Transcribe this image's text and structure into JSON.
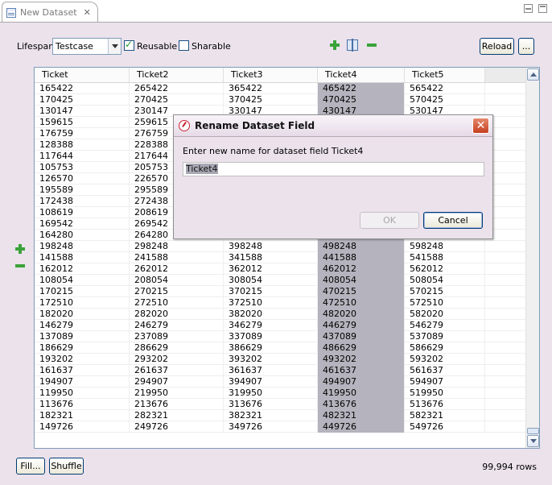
{
  "tab": {
    "title": "New Dataset",
    "close": "✕"
  },
  "toolbar": {
    "lifespan_label": "Lifespan",
    "lifespan_value": "Testcase",
    "reusable_label": "Reusable",
    "reusable_checked": true,
    "sharable_label": "Sharable",
    "sharable_checked": false,
    "reload_label": "Reload",
    "more_label": "..."
  },
  "table": {
    "columns": [
      "Ticket",
      "Ticket2",
      "Ticket3",
      "Ticket4",
      "Ticket5",
      ""
    ],
    "selected_column": "Ticket4",
    "rows": [
      [
        "165422",
        "265422",
        "365422",
        "465422",
        "565422"
      ],
      [
        "170425",
        "270425",
        "370425",
        "470425",
        "570425"
      ],
      [
        "130147",
        "230147",
        "330147",
        "430147",
        "530147"
      ],
      [
        "159615",
        "259615",
        "",
        "",
        ""
      ],
      [
        "176759",
        "276759",
        "",
        "",
        ""
      ],
      [
        "128388",
        "228388",
        "",
        "",
        ""
      ],
      [
        "117644",
        "217644",
        "",
        "",
        ""
      ],
      [
        "105753",
        "205753",
        "",
        "",
        ""
      ],
      [
        "126570",
        "226570",
        "",
        "",
        ""
      ],
      [
        "195589",
        "295589",
        "",
        "",
        ""
      ],
      [
        "172438",
        "272438",
        "",
        "",
        ""
      ],
      [
        "108619",
        "208619",
        "",
        "",
        ""
      ],
      [
        "169542",
        "269542",
        "",
        "",
        ""
      ],
      [
        "164280",
        "264280",
        "",
        "",
        ""
      ],
      [
        "198248",
        "298248",
        "398248",
        "498248",
        "598248"
      ],
      [
        "141588",
        "241588",
        "341588",
        "441588",
        "541588"
      ],
      [
        "162012",
        "262012",
        "362012",
        "462012",
        "562012"
      ],
      [
        "108054",
        "208054",
        "308054",
        "408054",
        "508054"
      ],
      [
        "170215",
        "270215",
        "370215",
        "470215",
        "570215"
      ],
      [
        "172510",
        "272510",
        "372510",
        "472510",
        "572510"
      ],
      [
        "182020",
        "282020",
        "382020",
        "482020",
        "582020"
      ],
      [
        "146279",
        "246279",
        "346279",
        "446279",
        "546279"
      ],
      [
        "137089",
        "237089",
        "337089",
        "437089",
        "537089"
      ],
      [
        "186629",
        "286629",
        "386629",
        "486629",
        "586629"
      ],
      [
        "193202",
        "293202",
        "393202",
        "493202",
        "593202"
      ],
      [
        "161637",
        "261637",
        "361637",
        "461637",
        "561637"
      ],
      [
        "194907",
        "294907",
        "394907",
        "494907",
        "594907"
      ],
      [
        "119950",
        "219950",
        "319950",
        "419950",
        "519950"
      ],
      [
        "113676",
        "213676",
        "313676",
        "413676",
        "513676"
      ],
      [
        "182321",
        "282321",
        "382321",
        "482321",
        "582321"
      ],
      [
        "149726",
        "249726",
        "349726",
        "449726",
        "549726"
      ]
    ]
  },
  "footer": {
    "fill_label": "Fill...",
    "shuffle_label": "Shuffle",
    "rows_count": "99,994 rows"
  },
  "dialog": {
    "title": "Rename Dataset Field",
    "message": "Enter new name for dataset field Ticket4",
    "input_value": "Ticket4",
    "ok_label": "OK",
    "cancel_label": "Cancel",
    "close": "✕"
  }
}
